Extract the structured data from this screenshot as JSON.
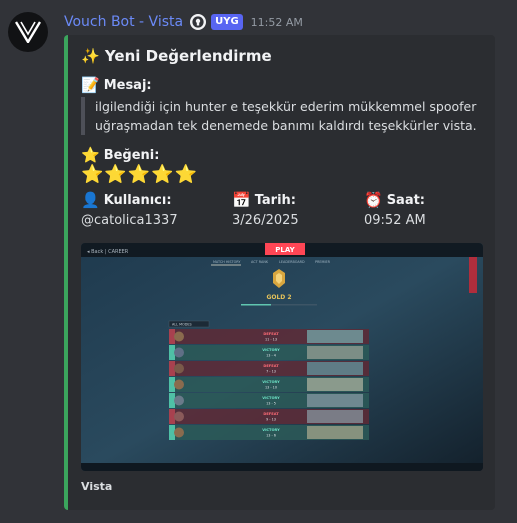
{
  "header": {
    "bot_name": "Vouch Bot - Vista",
    "app_tag": "UYG",
    "time": "11:52 AM"
  },
  "embed": {
    "accent_color": "#3ba55d",
    "title_emoji": "✨",
    "title": "Yeni Değerlendirme",
    "message_label_emoji": "📝",
    "message_label": "Mesaj:",
    "message": "ilgilendiği için hunter e teşekkür ederim mükkemmel spoofer uğraşmadan tek denemede banımı kaldırdı teşekkürler vista.",
    "rating_label_emoji": "⭐",
    "rating_label": "Beğeni:",
    "rating": 5,
    "rating_stars": "⭐⭐⭐⭐⭐",
    "user_label_emoji": "👤",
    "user_label": "Kullanıcı:",
    "user_value": "@catolica1337",
    "date_label_emoji": "📅",
    "date_label": "Tarih:",
    "date_value": "3/26/2025",
    "time_label_emoji": "⏰",
    "time_label": "Saat:",
    "time_value": "09:52 AM",
    "footer": "Vista"
  },
  "game_screenshot": {
    "top_left": "◂ Back | CAREER",
    "play_label": "PLAY",
    "tabs": [
      "MATCH HISTORY",
      "ACT RANK",
      "LEADERBOARD",
      "PREMIER"
    ],
    "rank": "GOLD 2",
    "filter": "ALL MODES",
    "matches": [
      {
        "result": "DEFEAT",
        "score": "11 - 13"
      },
      {
        "result": "VICTORY",
        "score": "13 - 4"
      },
      {
        "result": "DEFEAT",
        "score": "7 - 13"
      },
      {
        "result": "VICTORY",
        "score": "13 - 10"
      },
      {
        "result": "VICTORY",
        "score": "13 - 5"
      },
      {
        "result": "DEFEAT",
        "score": "9 - 13"
      },
      {
        "result": "VICTORY",
        "score": "13 - 6"
      }
    ]
  }
}
